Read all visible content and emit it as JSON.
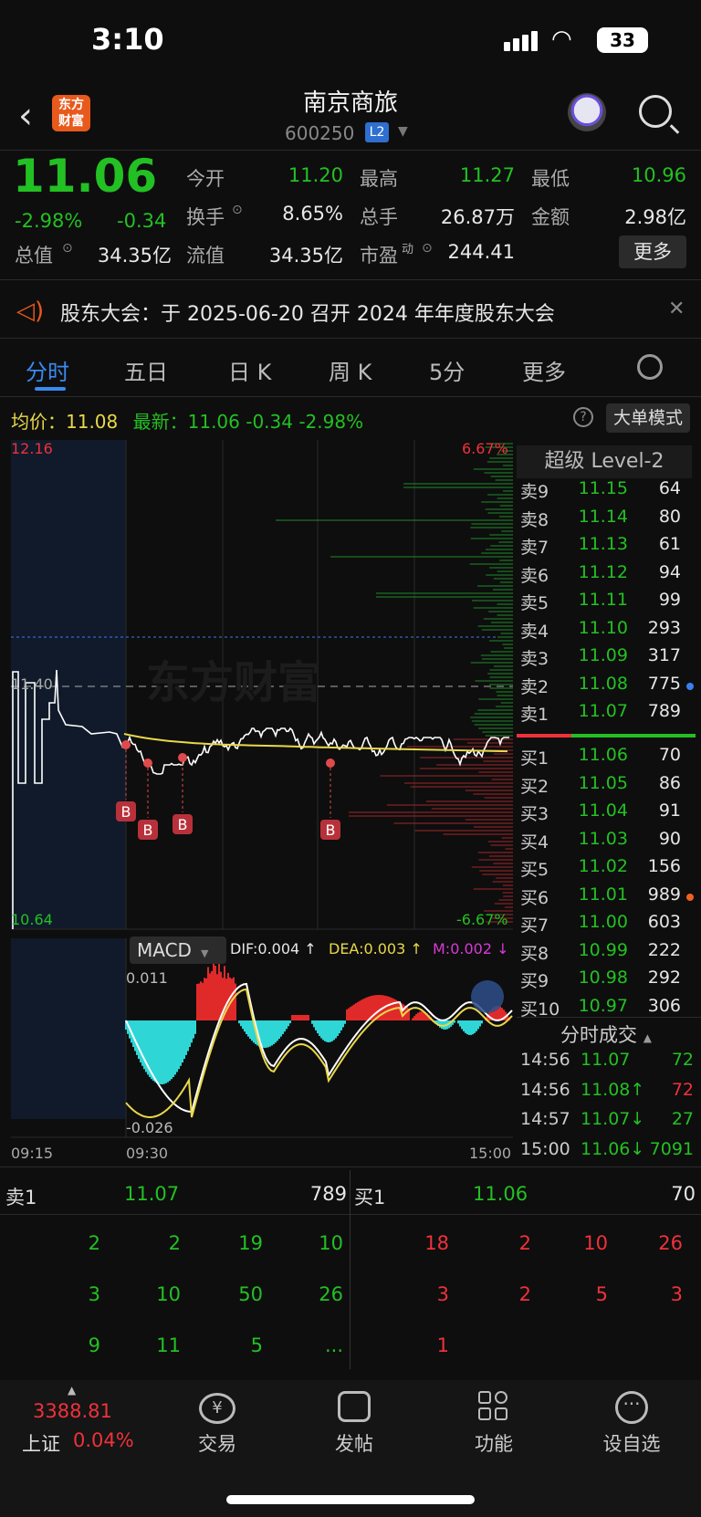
{
  "status": {
    "time": "3:10",
    "battery": "33"
  },
  "nav": {
    "name": "南京商旅",
    "code": "600250",
    "l2": "L2",
    "logo": "东方\n财富"
  },
  "quote": {
    "price": "11.06",
    "pct": "-2.98%",
    "chg": "-0.34",
    "open_label": "今开",
    "open": "11.20",
    "high_label": "最高",
    "high": "11.27",
    "low_label": "最低",
    "low": "10.96",
    "turnover_label": "换手",
    "turnover": "8.65%",
    "volume_label": "总手",
    "volume": "26.87万",
    "amount_label": "金额",
    "amount": "2.98亿",
    "mcap_label": "总值",
    "mcap": "34.35亿",
    "float_label": "流值",
    "float": "34.35亿",
    "pe_label": "市盈",
    "pe_sup": "动",
    "pe": "244.41",
    "more": "更多"
  },
  "notice": {
    "text": "股东大会：于 2025-06-20 召开 2024 年年度股东大会"
  },
  "tabs": [
    "分时",
    "五日",
    "日 K",
    "周 K",
    "5分",
    "更多"
  ],
  "avg": {
    "label": "均价：",
    "value": "11.08",
    "latest": "最新：11.06  -0.34  -2.98%"
  },
  "big_mode": "大单模式",
  "chart": {
    "top_price": "12.16",
    "mid_price": "11.40",
    "bottom_price": "10.64",
    "top_pct": "6.67%",
    "bottom_pct": "-6.67%",
    "b_label": "B",
    "time_start": "09:15",
    "time_open": "09:30",
    "time_end": "15:00",
    "macd_button": "MACD",
    "dif": "DIF:0.004 ↑",
    "dea": "DEA:0.003 ↑",
    "m": "M:0.002 ↓",
    "macd_top": "0.011",
    "macd_bottom": "-0.026",
    "watermark": "东方财富",
    "colors": {
      "price": "#ffffff",
      "avg": "#e8d84a",
      "up": "#f0313a",
      "down": "#23c023",
      "macd_neg": "#2fd6d6"
    }
  },
  "l2_title": "超级 Level-2",
  "orderbook": {
    "asks": [
      {
        "label": "卖9",
        "price": "11.15",
        "vol": "64"
      },
      {
        "label": "卖8",
        "price": "11.14",
        "vol": "80"
      },
      {
        "label": "卖7",
        "price": "11.13",
        "vol": "61"
      },
      {
        "label": "卖6",
        "price": "11.12",
        "vol": "94"
      },
      {
        "label": "卖5",
        "price": "11.11",
        "vol": "99"
      },
      {
        "label": "卖4",
        "price": "11.10",
        "vol": "293"
      },
      {
        "label": "卖3",
        "price": "11.09",
        "vol": "317"
      },
      {
        "label": "卖2",
        "price": "11.08",
        "vol": "775"
      },
      {
        "label": "卖1",
        "price": "11.07",
        "vol": "789"
      }
    ],
    "bids": [
      {
        "label": "买1",
        "price": "11.06",
        "vol": "70"
      },
      {
        "label": "买2",
        "price": "11.05",
        "vol": "86"
      },
      {
        "label": "买3",
        "price": "11.04",
        "vol": "91"
      },
      {
        "label": "买4",
        "price": "11.03",
        "vol": "90"
      },
      {
        "label": "买5",
        "price": "11.02",
        "vol": "156"
      },
      {
        "label": "买6",
        "price": "11.01",
        "vol": "989"
      },
      {
        "label": "买7",
        "price": "11.00",
        "vol": "603"
      },
      {
        "label": "买8",
        "price": "10.99",
        "vol": "222"
      },
      {
        "label": "买9",
        "price": "10.98",
        "vol": "292"
      },
      {
        "label": "买10",
        "price": "10.97",
        "vol": "306"
      }
    ]
  },
  "trades": {
    "title": "分时成交",
    "rows": [
      {
        "time": "14:56",
        "price": "11.07",
        "vol": "72"
      },
      {
        "time": "14:56",
        "price": "11.08↑",
        "vol": "72"
      },
      {
        "time": "14:57",
        "price": "11.07↓",
        "vol": "27"
      },
      {
        "time": "15:00",
        "price": "11.06↓",
        "vol": "7091"
      }
    ]
  },
  "level1": {
    "sell_label": "卖1",
    "sell_price": "11.07",
    "sell_vol": "789",
    "buy_label": "买1",
    "buy_price": "11.06",
    "buy_vol": "70",
    "sell_queue": [
      "2",
      "2",
      "19",
      "10",
      "3",
      "10",
      "50",
      "26",
      "9",
      "11",
      "5",
      "..."
    ],
    "buy_queue": [
      "18",
      "2",
      "10",
      "26",
      "3",
      "2",
      "5",
      "3",
      "1"
    ]
  },
  "tabbar": {
    "index_value": "3388.81",
    "index_name": "上证",
    "index_pct": "0.04%",
    "items": [
      "交易",
      "发帖",
      "功能",
      "设自选"
    ]
  }
}
